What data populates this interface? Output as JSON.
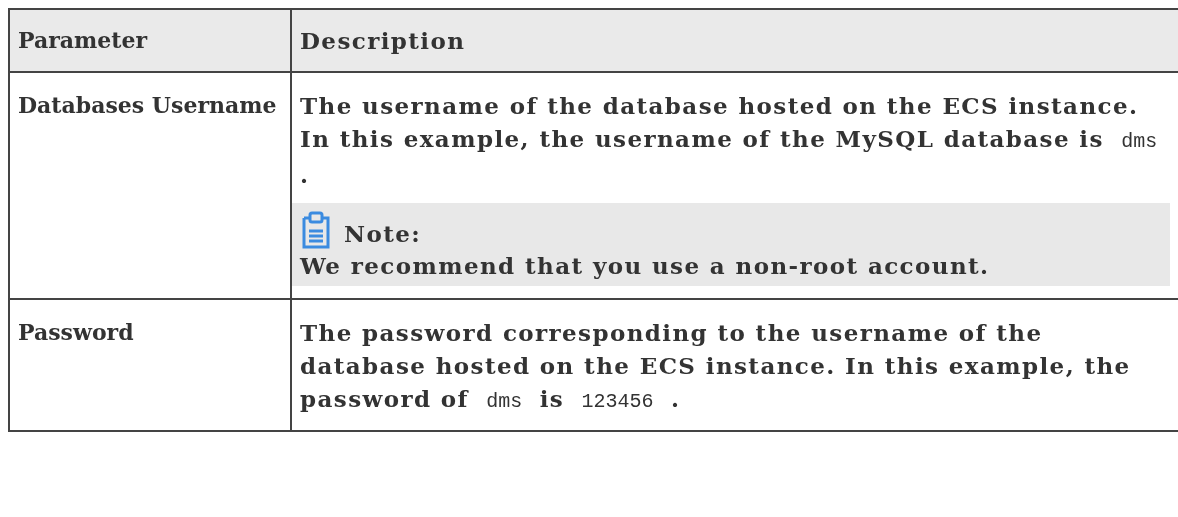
{
  "table": {
    "columns": [
      "Parameter",
      "Description"
    ],
    "rows": [
      {
        "parameter": "Databases Username",
        "paragraphs": [
          [
            {
              "kind": "text",
              "text": "The username of the database hosted on the ECS instance. In this example, the username of the MySQL database is "
            },
            {
              "kind": "code",
              "text": "dms"
            },
            {
              "kind": "text",
              "text": " ."
            }
          ]
        ],
        "note": {
          "label": "Note:",
          "text": "We recommend that you use a non-root account."
        }
      },
      {
        "parameter": "Password",
        "paragraphs": [
          [
            {
              "kind": "text",
              "text": "The password corresponding to the username of the database hosted on the ECS instance. In this example, the password of "
            },
            {
              "kind": "code",
              "text": "dms"
            },
            {
              "kind": "text",
              "text": " is "
            },
            {
              "kind": "code",
              "text": "123456"
            },
            {
              "kind": "text",
              "text": " ."
            }
          ]
        ]
      }
    ]
  }
}
